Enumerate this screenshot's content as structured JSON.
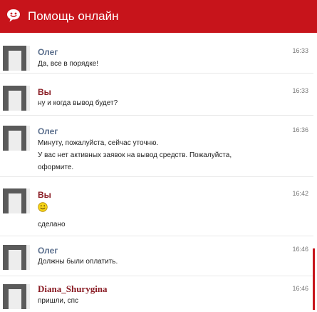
{
  "header": {
    "title": "Помощь онлайн",
    "color": "#c7141b"
  },
  "messages": [
    {
      "author": "Олег",
      "time": "16:33",
      "lines": [
        "Да, все в порядке!"
      ]
    },
    {
      "author": "Вы",
      "time": "16:33",
      "lines": [
        "ну и когда вывод будет?"
      ]
    },
    {
      "author": "Олег",
      "time": "16:36",
      "lines": [
        "Минуту, пожалуйста, сейчас уточню.",
        "У вас нет активных заявок на вывод средств. Пожалуйста,",
        "оформите."
      ]
    },
    {
      "author": "Вы",
      "time": "16:42",
      "emoji": "smile-emoji",
      "lines": [
        "сделано"
      ]
    },
    {
      "author": "Олег",
      "time": "16:46",
      "lines": [
        "Должны были оплатить."
      ]
    },
    {
      "author": "Diana_Shurygina",
      "time": "16:46",
      "lines": [
        "пришли, спс"
      ]
    }
  ]
}
